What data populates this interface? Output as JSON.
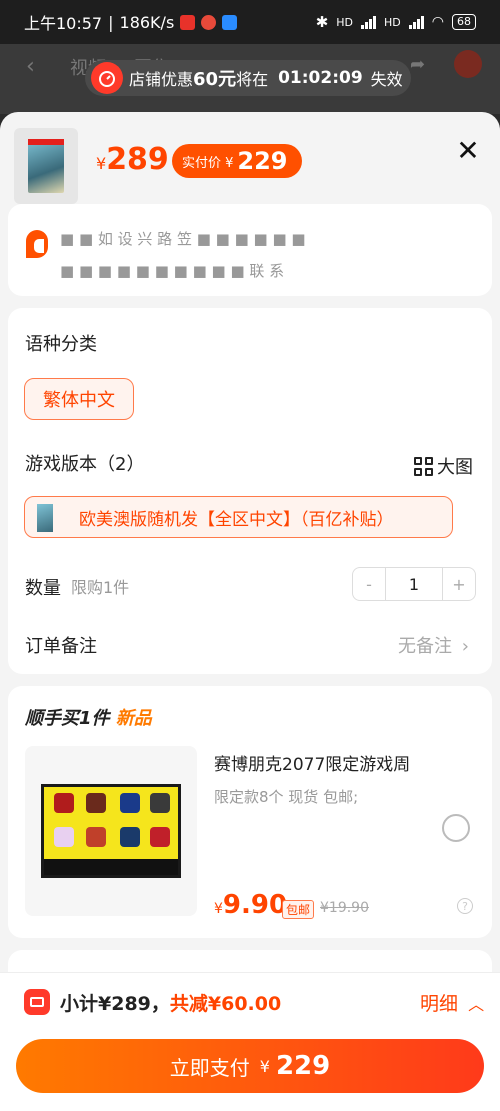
{
  "status_bar": {
    "time": "上午10:57",
    "speed": "186K/s",
    "hd1": "HD",
    "hd2": "HD",
    "battery": "68"
  },
  "background_nav": {
    "tab1": "视频",
    "tab2": "图集"
  },
  "promo": {
    "text_before": "店铺优惠",
    "amount": "60元",
    "text_mid": "将在",
    "timer": "01:02:09",
    "text_after": "失效"
  },
  "product": {
    "price_symbol": "¥",
    "price": "289",
    "paid_label": "实付价 ¥",
    "paid_price": "229"
  },
  "address": {
    "line1": "■ ■ 如 设 兴 路 笠 ■ ■ ■ ■ ■ ■",
    "line2": "■ ■ ■ ■ ■ ■ ■ ■ ■ ■ 联 系"
  },
  "options": {
    "language_label": "语种分类",
    "language_value": "繁体中文",
    "version_label": "游戏版本（2）",
    "view_big": "大图",
    "version_value": "欧美澳版随机发【全区中文】（百亿补贴）",
    "qty_label": "数量",
    "qty_limit": "限购1件",
    "qty_minus": "-",
    "qty_value": "1",
    "qty_plus": "+",
    "note_label": "订单备注",
    "note_value": "无备注"
  },
  "recommend": {
    "title_prefix": "顺手买1件",
    "title_new": "新品",
    "name": "赛博朋克2077限定游戏周",
    "desc": "限定款8个 现货 包邮;",
    "price_symbol": "¥",
    "price": "9.90",
    "shipping": "包邮",
    "original_price": "¥19.90",
    "help": "?"
  },
  "footer": {
    "subtotal": "小计¥289，",
    "discount": "共减¥60.00",
    "detail": "明细",
    "pay_label": "立即支付",
    "pay_symbol": "¥",
    "pay_amount": "229"
  },
  "colors": {
    "accent": "#ff5000",
    "price": "#ff4400"
  }
}
